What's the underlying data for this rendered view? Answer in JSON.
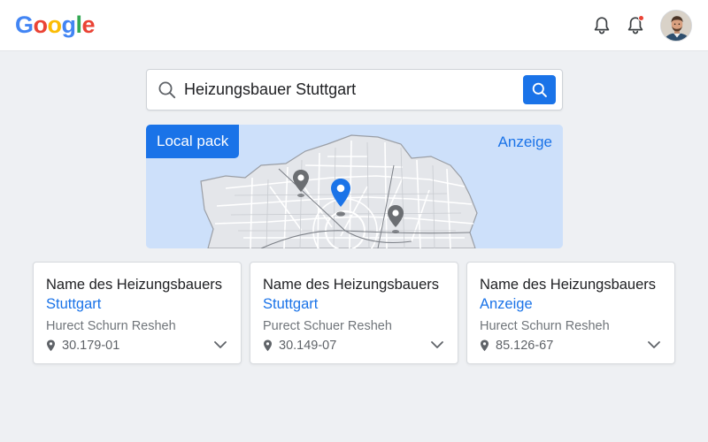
{
  "header": {
    "logo_letters": [
      {
        "char": "G",
        "color": "#4285F4"
      },
      {
        "char": "o",
        "color": "#EA4335"
      },
      {
        "char": "o",
        "color": "#FBBC05"
      },
      {
        "char": "g",
        "color": "#4285F4"
      },
      {
        "char": "l",
        "color": "#34A853"
      },
      {
        "char": "e",
        "color": "#EA4335"
      }
    ],
    "icons": [
      "bell-icon",
      "bell-icon-with-badge",
      "avatar"
    ],
    "badge_color": "#EA4335"
  },
  "search": {
    "query": "Heizungsbauer Stuttgart",
    "submit_color": "#1a73e8",
    "icons": [
      "search-icon",
      "search-icon"
    ]
  },
  "map": {
    "label": "Local pack",
    "label_color": "#1a73e8",
    "ad_label": "Anzeige",
    "ad_color": "#1a73e8",
    "pins": [
      {
        "name": "map-pin-gray",
        "color": "#6b6e72"
      },
      {
        "name": "map-pin-blue",
        "color": "#1a73e8"
      },
      {
        "name": "map-pin-gray",
        "color": "#6b6e72"
      }
    ]
  },
  "colors": {
    "link": "#1a73e8",
    "text": "#202124",
    "muted": "#70757a"
  },
  "cards": [
    {
      "title": "Name des Heizungsbauers",
      "subtitle": "Stuttgart",
      "address": "Hurect Schurn Resheh",
      "phone": "30.179-01"
    },
    {
      "title": "Name des Heizungsbauers",
      "subtitle": "Stuttgart",
      "address": "Purect Schuer Resheh",
      "phone": "30.149-07"
    },
    {
      "title": "Name des Heizungsbauers",
      "subtitle": "Anzeige",
      "address": "Hurect Schurn Resheh",
      "phone": "85.126-67"
    }
  ]
}
